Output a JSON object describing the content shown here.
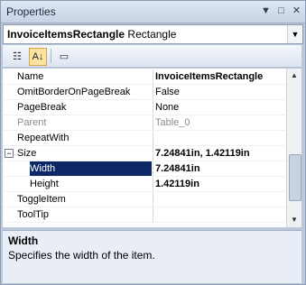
{
  "window": {
    "title": "Properties"
  },
  "titlebar_buttons": [
    "▼",
    "□",
    "✕"
  ],
  "selector": {
    "name": "InvoiceItemsRectangle",
    "type": "Rectangle"
  },
  "toolbar": {
    "categorized": "Categorized",
    "alphabetical": "Alphabetical",
    "property_pages": "Property Pages"
  },
  "properties": [
    {
      "name": "Name",
      "value": "InvoiceItemsRectangle",
      "bold": true
    },
    {
      "name": "OmitBorderOnPageBreak",
      "value": "False"
    },
    {
      "name": "PageBreak",
      "value": "None"
    },
    {
      "name": "Parent",
      "value": "Table_0",
      "disabled": true
    },
    {
      "name": "RepeatWith",
      "value": ""
    },
    {
      "name": "Size",
      "value": "7.24841in, 1.42119in",
      "bold": true,
      "expanded": true
    },
    {
      "name": "Width",
      "value": "7.24841in",
      "bold": true,
      "child": true,
      "selected": true
    },
    {
      "name": "Height",
      "value": "1.42119in",
      "bold": true,
      "child": true
    },
    {
      "name": "ToggleItem",
      "value": ""
    },
    {
      "name": "ToolTip",
      "value": ""
    }
  ],
  "description": {
    "title": "Width",
    "text": "Specifies the width of the item."
  }
}
